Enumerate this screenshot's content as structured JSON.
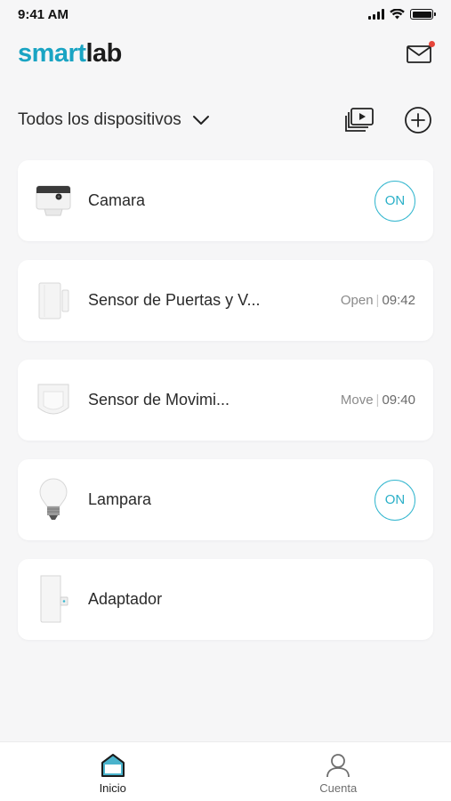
{
  "status_bar": {
    "time": "9:41 AM"
  },
  "header": {
    "logo_smart": "smart",
    "logo_lab": "lab",
    "mail_has_notification": true
  },
  "filter": {
    "label": "Todos los dispositivos"
  },
  "devices": [
    {
      "name": "Camara",
      "status": "",
      "status_time": "",
      "toggle_label": "ON",
      "icon": "camera-icon"
    },
    {
      "name": "Sensor de Puertas y V...",
      "status": "Open",
      "status_time": "09:42",
      "toggle_label": "",
      "icon": "door-sensor-icon"
    },
    {
      "name": "Sensor de Movimi...",
      "status": "Move",
      "status_time": "09:40",
      "toggle_label": "",
      "icon": "motion-sensor-icon"
    },
    {
      "name": "Lampara",
      "status": "",
      "status_time": "",
      "toggle_label": "ON",
      "icon": "bulb-icon"
    },
    {
      "name": "Adaptador",
      "status": "",
      "status_time": "",
      "toggle_label": "",
      "icon": "adapter-icon"
    }
  ],
  "nav": {
    "items": [
      {
        "label": "Inicio",
        "icon": "home-icon",
        "active": true
      },
      {
        "label": "Cuenta",
        "icon": "user-icon",
        "active": false
      }
    ]
  },
  "colors": {
    "accent": "#1aa4c3",
    "toggle_border": "#34b7cf",
    "notification_dot": "#e6453a",
    "background": "#f6f6f7"
  }
}
